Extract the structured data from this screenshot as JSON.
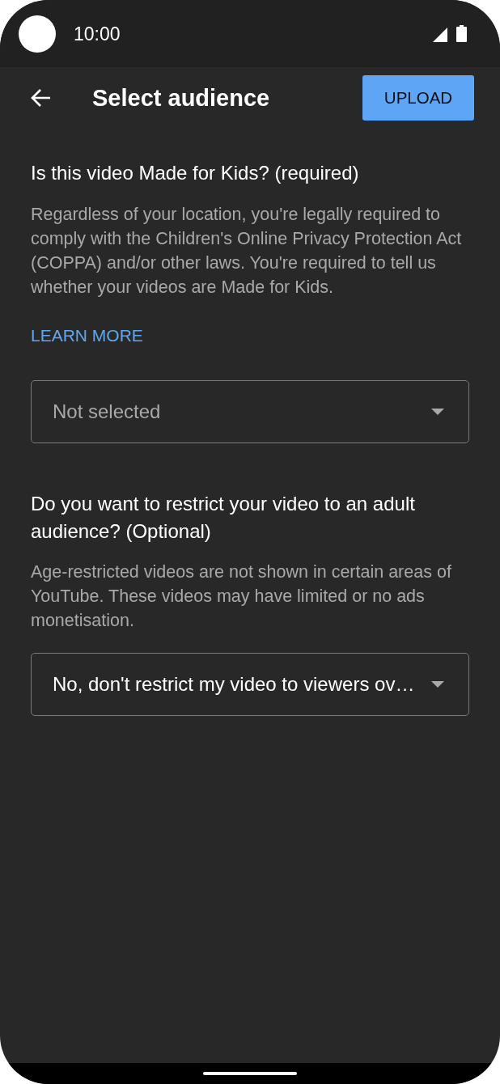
{
  "status_bar": {
    "time": "10:00"
  },
  "app_bar": {
    "title": "Select audience",
    "action": "UPLOAD"
  },
  "sections": [
    {
      "heading": "Is this video Made for Kids? (required)",
      "description": "Regardless of your location, you're legally required to comply with the Children's Online Privacy Protection Act (COPPA) and/or other laws. You're required to tell us whether your videos are Made for Kids.",
      "link": "LEARN MORE",
      "dropdown": {
        "placeholder": "Not selected"
      }
    },
    {
      "heading": "Do you want to restrict your video to an adult audience? (Optional)",
      "description": "Age-restricted videos are not shown in certain areas of YouTube. These videos may have limited or no ads monetisation.",
      "dropdown": {
        "value": "No, don't restrict my video to viewers ov…"
      }
    }
  ]
}
